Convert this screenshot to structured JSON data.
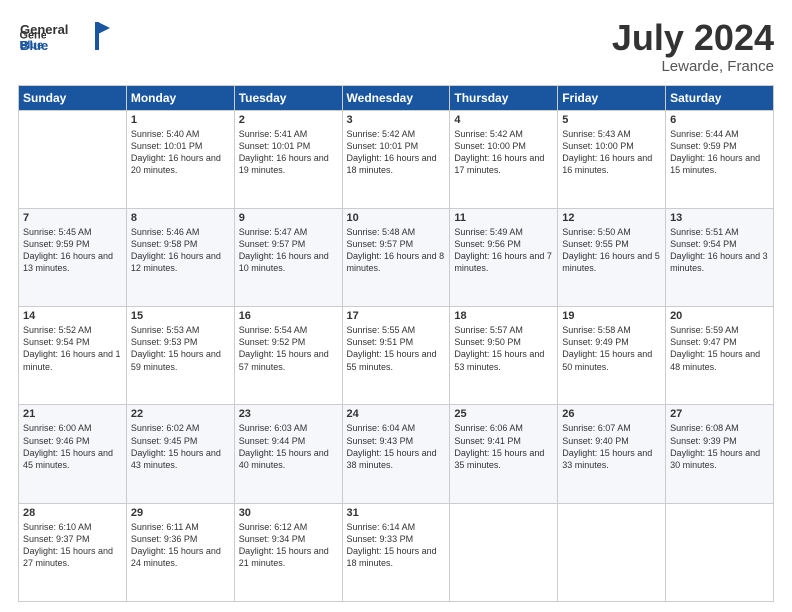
{
  "header": {
    "logo_line1": "General",
    "logo_line2": "Blue",
    "title": "July 2024",
    "subtitle": "Lewarde, France"
  },
  "columns": [
    "Sunday",
    "Monday",
    "Tuesday",
    "Wednesday",
    "Thursday",
    "Friday",
    "Saturday"
  ],
  "weeks": [
    [
      {
        "day": "",
        "sunrise": "",
        "sunset": "",
        "daylight": ""
      },
      {
        "day": "1",
        "sunrise": "Sunrise: 5:40 AM",
        "sunset": "Sunset: 10:01 PM",
        "daylight": "Daylight: 16 hours and 20 minutes."
      },
      {
        "day": "2",
        "sunrise": "Sunrise: 5:41 AM",
        "sunset": "Sunset: 10:01 PM",
        "daylight": "Daylight: 16 hours and 19 minutes."
      },
      {
        "day": "3",
        "sunrise": "Sunrise: 5:42 AM",
        "sunset": "Sunset: 10:01 PM",
        "daylight": "Daylight: 16 hours and 18 minutes."
      },
      {
        "day": "4",
        "sunrise": "Sunrise: 5:42 AM",
        "sunset": "Sunset: 10:00 PM",
        "daylight": "Daylight: 16 hours and 17 minutes."
      },
      {
        "day": "5",
        "sunrise": "Sunrise: 5:43 AM",
        "sunset": "Sunset: 10:00 PM",
        "daylight": "Daylight: 16 hours and 16 minutes."
      },
      {
        "day": "6",
        "sunrise": "Sunrise: 5:44 AM",
        "sunset": "Sunset: 9:59 PM",
        "daylight": "Daylight: 16 hours and 15 minutes."
      }
    ],
    [
      {
        "day": "7",
        "sunrise": "Sunrise: 5:45 AM",
        "sunset": "Sunset: 9:59 PM",
        "daylight": "Daylight: 16 hours and 13 minutes."
      },
      {
        "day": "8",
        "sunrise": "Sunrise: 5:46 AM",
        "sunset": "Sunset: 9:58 PM",
        "daylight": "Daylight: 16 hours and 12 minutes."
      },
      {
        "day": "9",
        "sunrise": "Sunrise: 5:47 AM",
        "sunset": "Sunset: 9:57 PM",
        "daylight": "Daylight: 16 hours and 10 minutes."
      },
      {
        "day": "10",
        "sunrise": "Sunrise: 5:48 AM",
        "sunset": "Sunset: 9:57 PM",
        "daylight": "Daylight: 16 hours and 8 minutes."
      },
      {
        "day": "11",
        "sunrise": "Sunrise: 5:49 AM",
        "sunset": "Sunset: 9:56 PM",
        "daylight": "Daylight: 16 hours and 7 minutes."
      },
      {
        "day": "12",
        "sunrise": "Sunrise: 5:50 AM",
        "sunset": "Sunset: 9:55 PM",
        "daylight": "Daylight: 16 hours and 5 minutes."
      },
      {
        "day": "13",
        "sunrise": "Sunrise: 5:51 AM",
        "sunset": "Sunset: 9:54 PM",
        "daylight": "Daylight: 16 hours and 3 minutes."
      }
    ],
    [
      {
        "day": "14",
        "sunrise": "Sunrise: 5:52 AM",
        "sunset": "Sunset: 9:54 PM",
        "daylight": "Daylight: 16 hours and 1 minute."
      },
      {
        "day": "15",
        "sunrise": "Sunrise: 5:53 AM",
        "sunset": "Sunset: 9:53 PM",
        "daylight": "Daylight: 15 hours and 59 minutes."
      },
      {
        "day": "16",
        "sunrise": "Sunrise: 5:54 AM",
        "sunset": "Sunset: 9:52 PM",
        "daylight": "Daylight: 15 hours and 57 minutes."
      },
      {
        "day": "17",
        "sunrise": "Sunrise: 5:55 AM",
        "sunset": "Sunset: 9:51 PM",
        "daylight": "Daylight: 15 hours and 55 minutes."
      },
      {
        "day": "18",
        "sunrise": "Sunrise: 5:57 AM",
        "sunset": "Sunset: 9:50 PM",
        "daylight": "Daylight: 15 hours and 53 minutes."
      },
      {
        "day": "19",
        "sunrise": "Sunrise: 5:58 AM",
        "sunset": "Sunset: 9:49 PM",
        "daylight": "Daylight: 15 hours and 50 minutes."
      },
      {
        "day": "20",
        "sunrise": "Sunrise: 5:59 AM",
        "sunset": "Sunset: 9:47 PM",
        "daylight": "Daylight: 15 hours and 48 minutes."
      }
    ],
    [
      {
        "day": "21",
        "sunrise": "Sunrise: 6:00 AM",
        "sunset": "Sunset: 9:46 PM",
        "daylight": "Daylight: 15 hours and 45 minutes."
      },
      {
        "day": "22",
        "sunrise": "Sunrise: 6:02 AM",
        "sunset": "Sunset: 9:45 PM",
        "daylight": "Daylight: 15 hours and 43 minutes."
      },
      {
        "day": "23",
        "sunrise": "Sunrise: 6:03 AM",
        "sunset": "Sunset: 9:44 PM",
        "daylight": "Daylight: 15 hours and 40 minutes."
      },
      {
        "day": "24",
        "sunrise": "Sunrise: 6:04 AM",
        "sunset": "Sunset: 9:43 PM",
        "daylight": "Daylight: 15 hours and 38 minutes."
      },
      {
        "day": "25",
        "sunrise": "Sunrise: 6:06 AM",
        "sunset": "Sunset: 9:41 PM",
        "daylight": "Daylight: 15 hours and 35 minutes."
      },
      {
        "day": "26",
        "sunrise": "Sunrise: 6:07 AM",
        "sunset": "Sunset: 9:40 PM",
        "daylight": "Daylight: 15 hours and 33 minutes."
      },
      {
        "day": "27",
        "sunrise": "Sunrise: 6:08 AM",
        "sunset": "Sunset: 9:39 PM",
        "daylight": "Daylight: 15 hours and 30 minutes."
      }
    ],
    [
      {
        "day": "28",
        "sunrise": "Sunrise: 6:10 AM",
        "sunset": "Sunset: 9:37 PM",
        "daylight": "Daylight: 15 hours and 27 minutes."
      },
      {
        "day": "29",
        "sunrise": "Sunrise: 6:11 AM",
        "sunset": "Sunset: 9:36 PM",
        "daylight": "Daylight: 15 hours and 24 minutes."
      },
      {
        "day": "30",
        "sunrise": "Sunrise: 6:12 AM",
        "sunset": "Sunset: 9:34 PM",
        "daylight": "Daylight: 15 hours and 21 minutes."
      },
      {
        "day": "31",
        "sunrise": "Sunrise: 6:14 AM",
        "sunset": "Sunset: 9:33 PM",
        "daylight": "Daylight: 15 hours and 18 minutes."
      },
      {
        "day": "",
        "sunrise": "",
        "sunset": "",
        "daylight": ""
      },
      {
        "day": "",
        "sunrise": "",
        "sunset": "",
        "daylight": ""
      },
      {
        "day": "",
        "sunrise": "",
        "sunset": "",
        "daylight": ""
      }
    ]
  ]
}
